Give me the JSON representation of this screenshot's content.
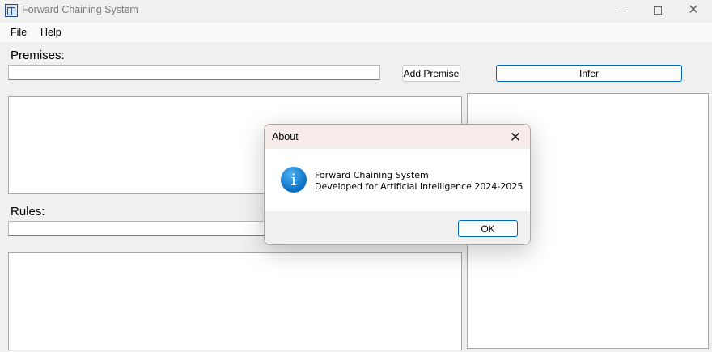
{
  "window": {
    "title": "Forward Chaining System",
    "minimize_icon": "minimize-icon",
    "maximize_icon": "maximize-icon",
    "close_icon": "close-icon",
    "close_glyph": "✕"
  },
  "menu": {
    "items": [
      {
        "label": "File"
      },
      {
        "label": "Help"
      }
    ]
  },
  "premises": {
    "label": "Premises:",
    "input_value": "",
    "add_button_label": "Add Premise"
  },
  "rules": {
    "label": "Rules:",
    "input_value": ""
  },
  "infer": {
    "button_label": "Infer"
  },
  "dialog": {
    "title": "About",
    "close_glyph": "✕",
    "icon": "info-icon",
    "icon_glyph": "i",
    "line1": "Forward Chaining System",
    "line2": "Developed for Artificial Intelligence 2024-2025",
    "ok_label": "OK"
  },
  "colors": {
    "accent": "#0067c0",
    "window_background": "#f0f0f0",
    "dialog_title_background": "#f7ecea",
    "info_icon": "#0a6fc4"
  }
}
